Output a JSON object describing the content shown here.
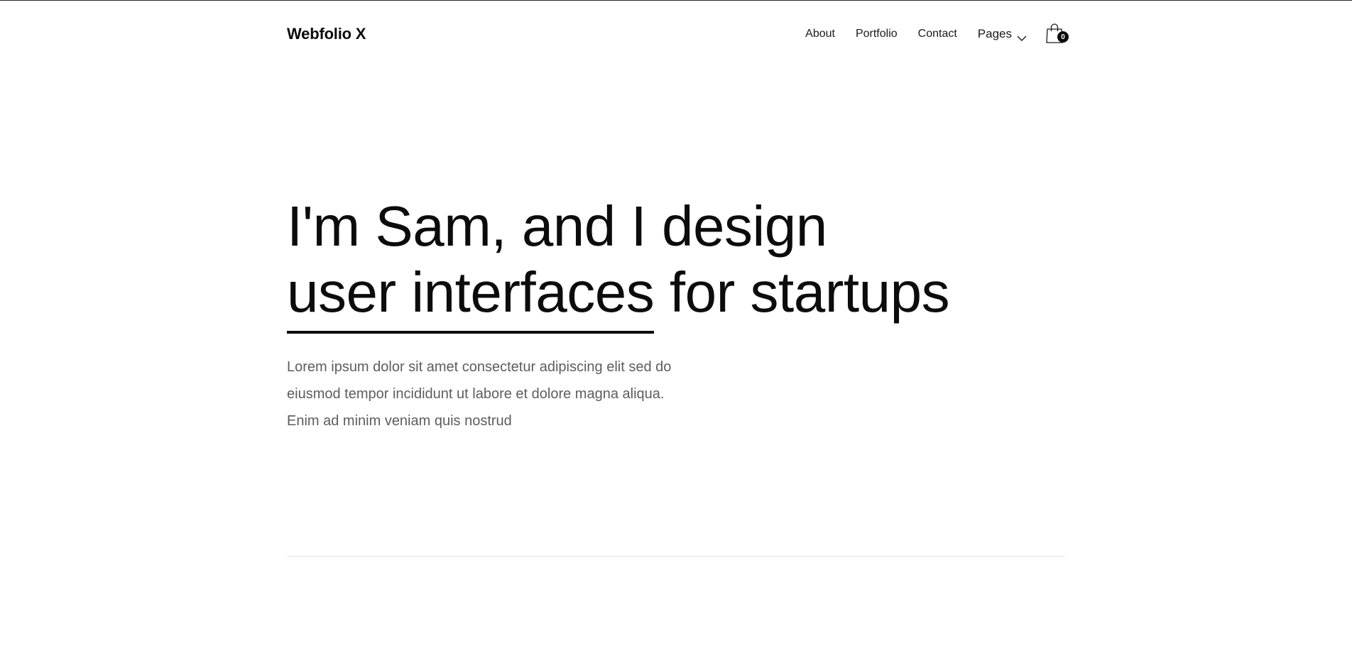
{
  "header": {
    "brand": "Webfolio X",
    "nav": {
      "about": "About",
      "portfolio": "Portfolio",
      "contact": "Contact",
      "pages": "Pages"
    },
    "cart": {
      "icon": "shopping-bag-icon",
      "count": "0"
    }
  },
  "hero": {
    "title_line1": "I'm Sam, and I design",
    "title_highlight": "user interfaces",
    "title_rest": " for startups",
    "paragraph_line1": "Lorem ipsum dolor sit amet consectetur adipiscing elit sed do",
    "paragraph_line2": "eiusmod tempor incididunt ut labore et dolore magna aliqua.",
    "paragraph_line3": "Enim ad minim veniam quis nostrud"
  },
  "colors": {
    "text": "#0c0c0c",
    "body_text": "#5d5d5d",
    "divider": "#e1e1e1",
    "background": "#ffffff"
  }
}
